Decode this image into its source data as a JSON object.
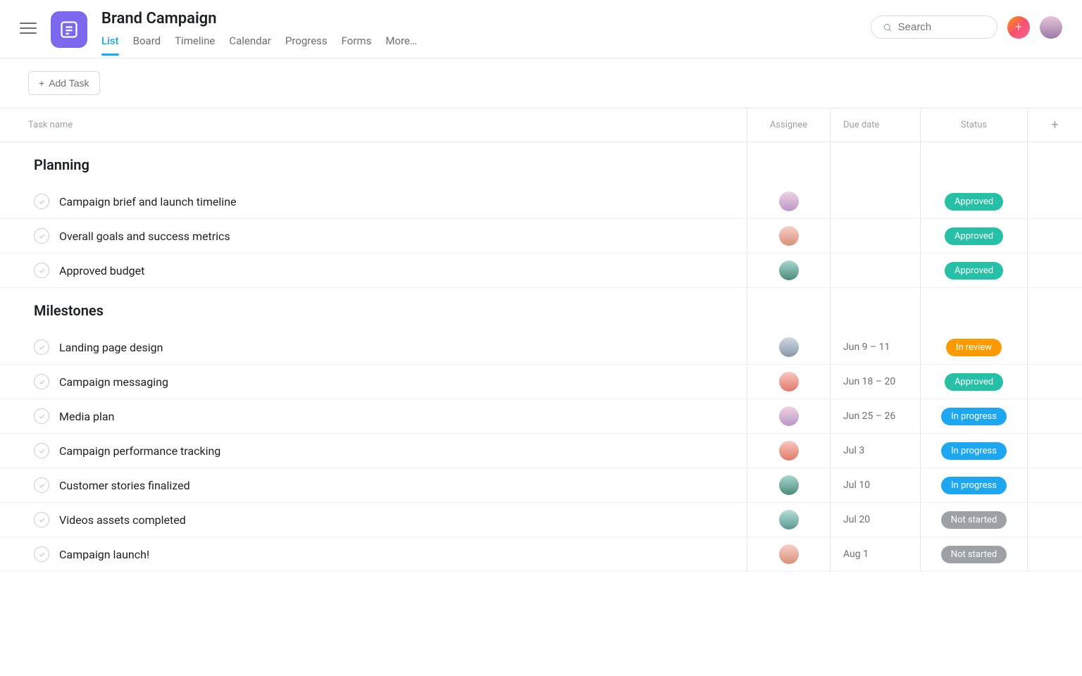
{
  "header": {
    "title": "Brand Campaign",
    "tabs": [
      "List",
      "Board",
      "Timeline",
      "Calendar",
      "Progress",
      "Forms",
      "More…"
    ],
    "active_tab": "List",
    "search_placeholder": "Search"
  },
  "toolbar": {
    "add_task_label": "Add Task"
  },
  "columns": {
    "task": "Task name",
    "assignee": "Assignee",
    "due": "Due date",
    "status": "Status"
  },
  "status_labels": {
    "approved": "Approved",
    "in_review": "In review",
    "in_progress": "In progress",
    "not_started": "Not started"
  },
  "sections": [
    {
      "name": "Planning",
      "tasks": [
        {
          "name": "Campaign brief and launch timeline",
          "assignee": "av1",
          "due": "",
          "status": "approved"
        },
        {
          "name": "Overall goals and success metrics",
          "assignee": "av2",
          "due": "",
          "status": "approved"
        },
        {
          "name": "Approved budget",
          "assignee": "av3",
          "due": "",
          "status": "approved"
        }
      ]
    },
    {
      "name": "Milestones",
      "tasks": [
        {
          "name": "Landing page design",
          "assignee": "av4",
          "due": "Jun 9 – 11",
          "status": "in_review"
        },
        {
          "name": "Campaign messaging",
          "assignee": "av5",
          "due": "Jun 18 – 20",
          "status": "approved"
        },
        {
          "name": "Media plan",
          "assignee": "av1",
          "due": "Jun 25 – 26",
          "status": "in_progress"
        },
        {
          "name": "Campaign performance tracking",
          "assignee": "av5",
          "due": "Jul 3",
          "status": "in_progress"
        },
        {
          "name": "Customer stories finalized",
          "assignee": "av3",
          "due": "Jul 10",
          "status": "in_progress"
        },
        {
          "name": "Videos assets completed",
          "assignee": "av6",
          "due": "Jul 20",
          "status": "not_started"
        },
        {
          "name": "Campaign launch!",
          "assignee": "av2",
          "due": "Aug 1",
          "status": "not_started"
        }
      ]
    }
  ]
}
